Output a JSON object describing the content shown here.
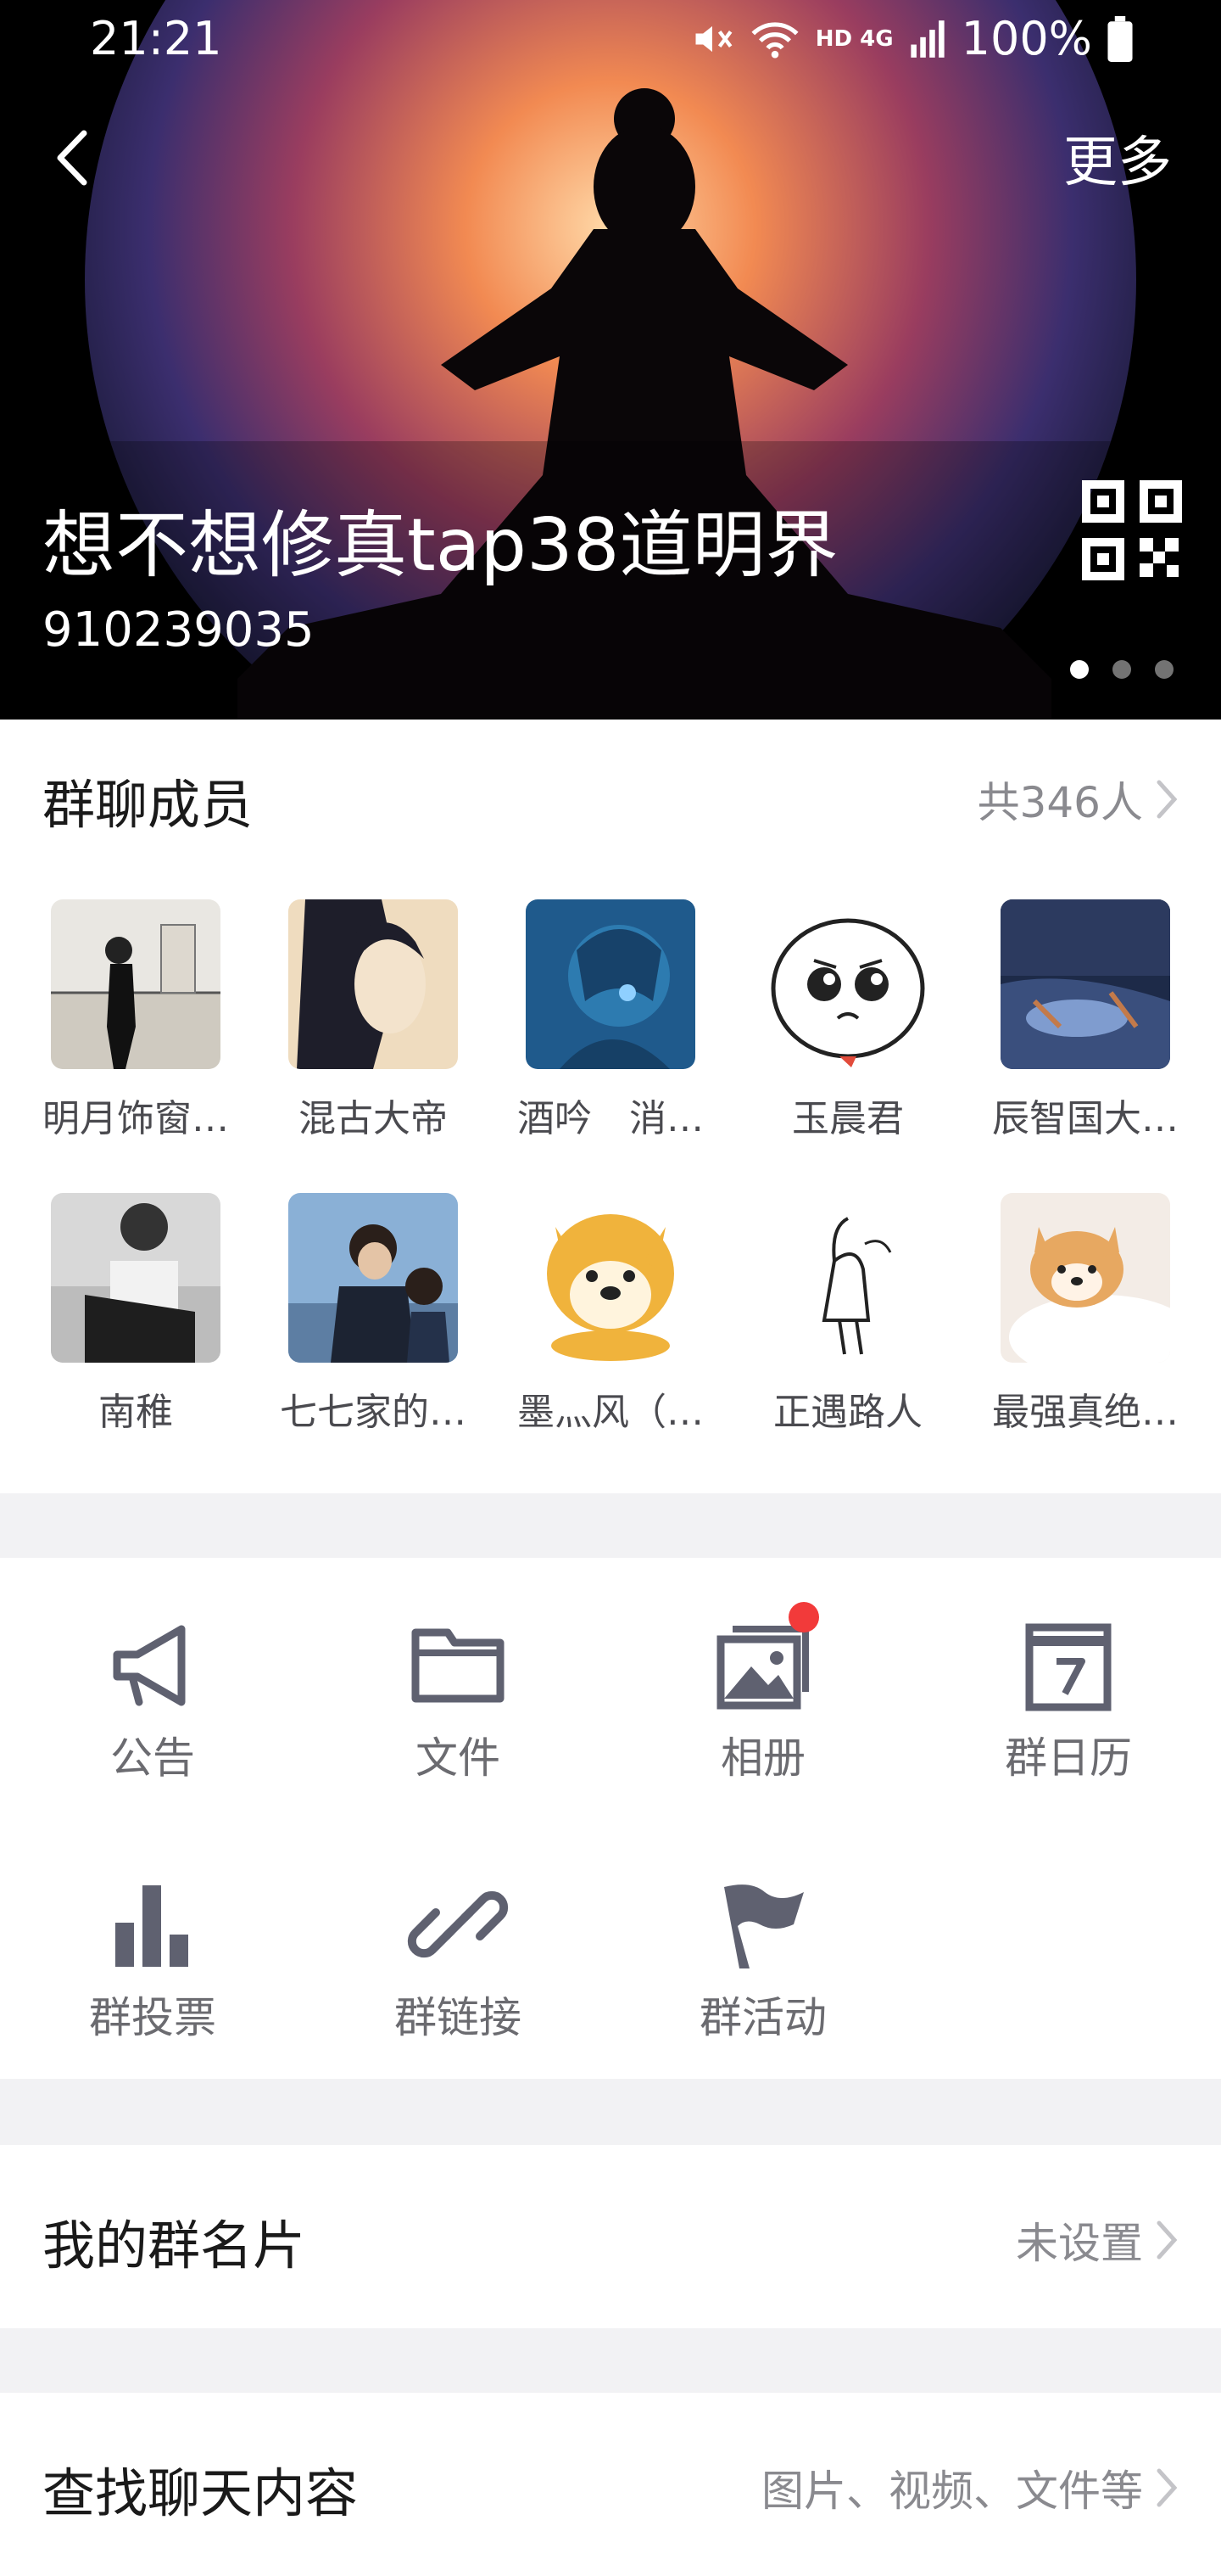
{
  "status_bar": {
    "time": "21:21",
    "battery_percent": "100%",
    "network_label": "HD 4G"
  },
  "header": {
    "back_icon": "chevron-left-icon",
    "more_label": "更多",
    "group_name": "想不想修真tap38道明界",
    "group_id": "910239035",
    "carousel_count": 3,
    "carousel_active": 0
  },
  "members": {
    "title": "群聊成员",
    "count_label": "共346人",
    "list": [
      {
        "name": "明月饰窗…"
      },
      {
        "name": "混古大帝"
      },
      {
        "name": "酒吟　消…"
      },
      {
        "name": "玉晨君"
      },
      {
        "name": "辰智国大…"
      },
      {
        "name": "南稚"
      },
      {
        "name": "七七家的…"
      },
      {
        "name": "墨灬风（…"
      },
      {
        "name": "正遇路人"
      },
      {
        "name": "最强真绝…"
      }
    ]
  },
  "tools": [
    {
      "label": "公告",
      "icon": "megaphone-icon"
    },
    {
      "label": "文件",
      "icon": "folder-icon"
    },
    {
      "label": "相册",
      "icon": "photo-album-icon",
      "badge": true
    },
    {
      "label": "群日历",
      "icon": "calendar-icon",
      "icon_text": "7"
    },
    {
      "label": "群投票",
      "icon": "bar-chart-icon"
    },
    {
      "label": "群链接",
      "icon": "link-icon"
    },
    {
      "label": "群活动",
      "icon": "flag-icon"
    }
  ],
  "rows": {
    "card": {
      "label": "我的群名片",
      "value": "未设置"
    },
    "search": {
      "label": "查找聊天内容",
      "value": "图片、视频、文件等"
    }
  },
  "colors": {
    "accent_badge": "#f23a3a",
    "icon_gray": "#5f6170",
    "secondary_text": "#8a8a8f",
    "divider_bg": "#f2f2f4"
  }
}
